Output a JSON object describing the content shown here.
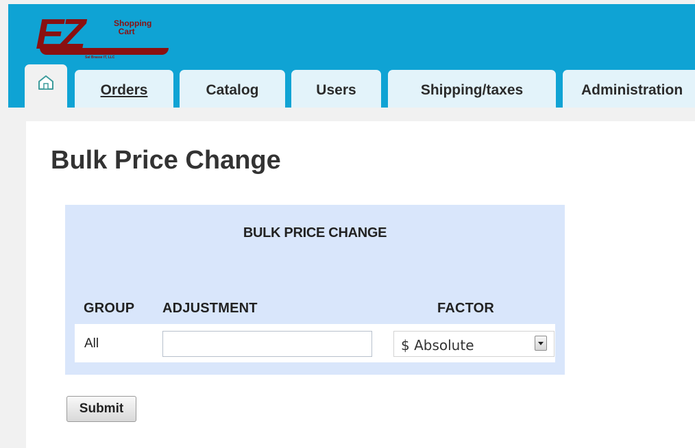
{
  "logo": {
    "brand": "EZ",
    "product": "Shopping\nCart",
    "tagline": "Sal Brasse IT, LLC"
  },
  "colors": {
    "header_bg": "#0fa3d4",
    "tab_bg": "#e3f3fa",
    "logo_red": "#8a1010",
    "form_bg": "#d9e6fb"
  },
  "nav": {
    "home_icon": "home-icon",
    "tabs": [
      {
        "label": "Orders",
        "active": true
      },
      {
        "label": "Catalog"
      },
      {
        "label": "Users"
      },
      {
        "label": "Shipping/taxes"
      },
      {
        "label": "Administration"
      }
    ]
  },
  "page": {
    "title": "Bulk Price Change"
  },
  "form": {
    "heading": "BULK PRICE CHANGE",
    "columns": {
      "group": "GROUP",
      "adjustment": "ADJUSTMENT",
      "factor": "FACTOR"
    },
    "row": {
      "group": "All",
      "adjustment_value": "",
      "factor_selected": "$ Absolute"
    },
    "submit_label": "Submit"
  }
}
